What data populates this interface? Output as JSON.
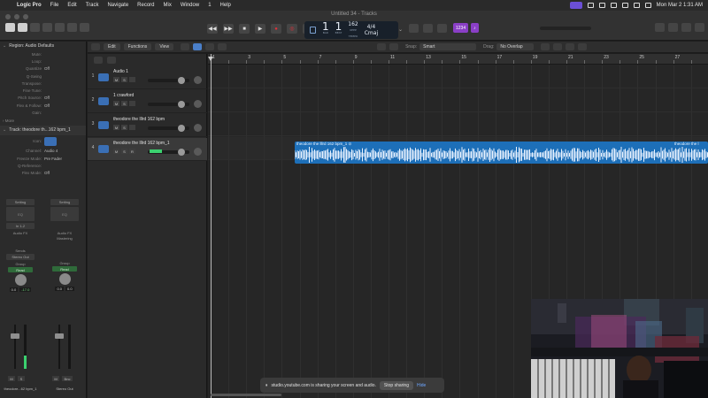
{
  "menubar": {
    "app": "Logic Pro",
    "menus": [
      "File",
      "Edit",
      "Track",
      "Navigate",
      "Record",
      "Mix",
      "Window",
      "1",
      "Help"
    ],
    "clock": "Mon Mar 2  1:31 AM"
  },
  "window": {
    "title": "Untitled 34 - Tracks"
  },
  "lcd": {
    "bar": "1",
    "beat": "1",
    "bar_label": "BAR",
    "beat_label": "BEAT",
    "tempo": "162",
    "tempo_label": "KEEP",
    "tempo_sub": "TEMPO",
    "sig": "4/4",
    "key": "Cmaj"
  },
  "chips": [
    "1234",
    "♪"
  ],
  "inspector": {
    "region_title": "Region: Audio Defaults",
    "region_params": [
      {
        "k": "Mute:",
        "v": ""
      },
      {
        "k": "Loop:",
        "v": ""
      },
      {
        "k": "Quantize",
        "v": "Off"
      },
      {
        "k": "Q-Swing",
        "v": ""
      },
      {
        "k": "Transpose:",
        "v": ""
      },
      {
        "k": "Fine Tune:",
        "v": ""
      },
      {
        "k": "Pitch Source:",
        "v": "Off"
      },
      {
        "k": "Flex & Follow:",
        "v": "Off"
      },
      {
        "k": "Gain:",
        "v": ""
      }
    ],
    "more": "More",
    "track_title": "Track:  theodore th...162 bpm_1",
    "track_params": [
      {
        "k": "Icon:",
        "v": ""
      },
      {
        "k": "Channel:",
        "v": "Audio 4"
      },
      {
        "k": "Freeze Mode:",
        "v": "Pre Fader"
      },
      {
        "k": "Q-Reference:",
        "v": ""
      },
      {
        "k": "Flex Mode:",
        "v": "Off"
      }
    ],
    "strips": [
      {
        "setting": "Setting",
        "eq": "EQ",
        "input": "In 1-2",
        "fx": "Audio FX",
        "sends": "Sends",
        "out": "Stereo Out",
        "group": "Group",
        "auto": "Read",
        "vol": "0.0",
        "peak": "-17.0",
        "ms": [
          "M",
          "S"
        ],
        "name": "theodore...62 bpm_1",
        "level": 0.3
      },
      {
        "setting": "Setting",
        "eq": "EQ",
        "input": "",
        "fx": "Audio FX",
        "sends": "Mastering",
        "out": "",
        "group": "Group",
        "auto": "Read",
        "vol": "0.0",
        "peak": "0.0",
        "ms": [
          "M",
          "S"
        ],
        "name": "Stereo Out",
        "level": 0.0,
        "bnc": "Bnc"
      }
    ]
  },
  "toolbar": {
    "edit": "Edit",
    "functions": "Functions",
    "view": "View",
    "snap_label": "Snap:",
    "snap_value": "Smart",
    "drag_label": "Drag:",
    "drag_value": "No Overlap"
  },
  "tracks": [
    {
      "num": "1",
      "name": "Audio 1",
      "ms": [
        "M",
        "S"
      ]
    },
    {
      "num": "2",
      "name": "1 crawford",
      "ms": [
        "M",
        "S"
      ]
    },
    {
      "num": "3",
      "name": "theodore the lllrd 162 bpm",
      "ms": [
        "M",
        "S"
      ]
    },
    {
      "num": "4",
      "name": "theodore the lllrd 162 bpm_1",
      "ms": [
        "M",
        "S",
        "R"
      ]
    }
  ],
  "ruler": {
    "bars": [
      "1",
      "3",
      "5",
      "7",
      "9",
      "11",
      "13",
      "15",
      "17",
      "19",
      "21",
      "23",
      "25",
      "27"
    ]
  },
  "region": {
    "name": "theodore the lllrd 162 bpm_1 ⊙",
    "name_repeat": "theodore the l"
  },
  "share": {
    "text": "studio.youtube.com is sharing your screen and audio.",
    "stop": "Stop sharing",
    "hide": "Hide"
  }
}
